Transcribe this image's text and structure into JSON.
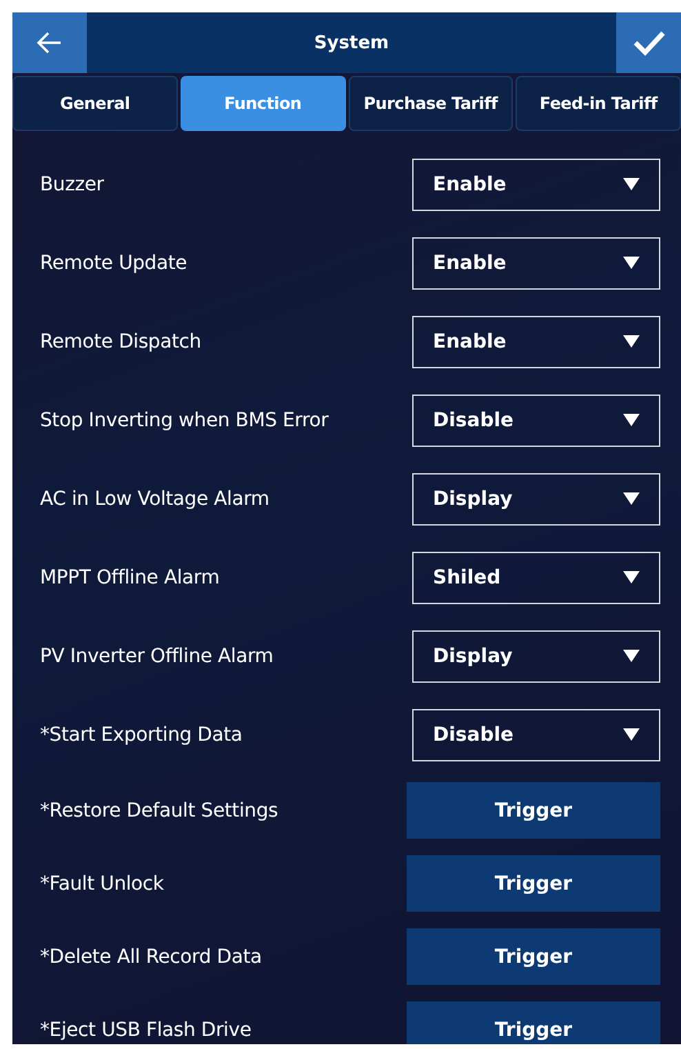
{
  "header": {
    "title": "System"
  },
  "tabs": [
    {
      "label": "General",
      "selected": false
    },
    {
      "label": "Function",
      "selected": true
    },
    {
      "label": "Purchase Tariff",
      "selected": false
    },
    {
      "label": "Feed-in Tariff",
      "selected": false
    }
  ],
  "rows": [
    {
      "label": "Buzzer",
      "kind": "dropdown",
      "value": "Enable"
    },
    {
      "label": "Remote Update",
      "kind": "dropdown",
      "value": "Enable"
    },
    {
      "label": "Remote Dispatch",
      "kind": "dropdown",
      "value": "Enable"
    },
    {
      "label": "Stop Inverting when BMS Error",
      "kind": "dropdown",
      "value": "Disable"
    },
    {
      "label": "AC in Low Voltage Alarm",
      "kind": "dropdown",
      "value": "Display"
    },
    {
      "label": "MPPT Offline Alarm",
      "kind": "dropdown",
      "value": "Shiled"
    },
    {
      "label": "PV Inverter Offline Alarm",
      "kind": "dropdown",
      "value": "Display"
    },
    {
      "label": "*Start Exporting Data",
      "kind": "dropdown",
      "value": "Disable"
    },
    {
      "label": "*Restore Default Settings",
      "kind": "button",
      "value": "Trigger"
    },
    {
      "label": "*Fault Unlock",
      "kind": "button",
      "value": "Trigger"
    },
    {
      "label": "*Delete All Record Data",
      "kind": "button",
      "value": "Trigger"
    },
    {
      "label": "*Eject USB Flash Drive",
      "kind": "button",
      "value": "Trigger"
    }
  ]
}
